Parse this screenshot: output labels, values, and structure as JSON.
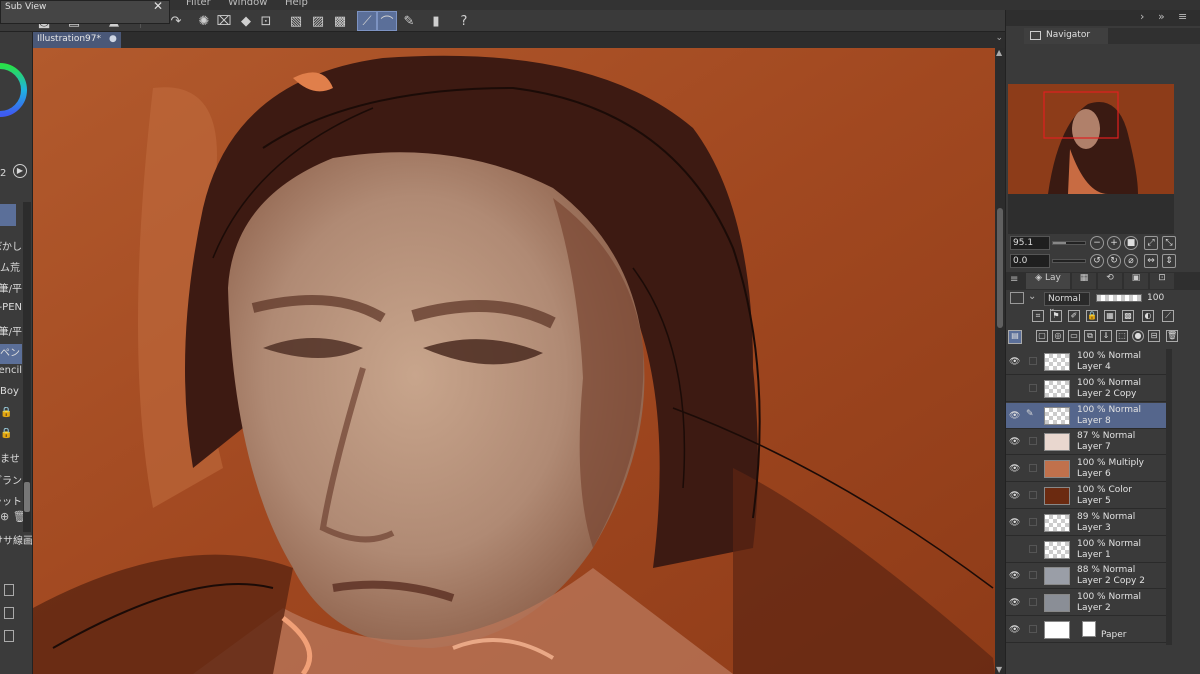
{
  "app": {
    "subview_title": "Sub View",
    "menu": [
      "Filter",
      "Window",
      "Help"
    ]
  },
  "document": {
    "tab_label": "Illustration97*"
  },
  "left_panel": {
    "color_value": "2",
    "items": [
      "ぼかし",
      "ム荒",
      "筆/平",
      "G-PEN",
      "筆/平",
      "ペン",
      "Pencil",
      "Boy",
      "",
      "",
      "ませ",
      "グラン",
      "ラット",
      "けサ線画"
    ]
  },
  "navigator": {
    "tab_label": "Navigator",
    "zoom": "95.1",
    "rotation": "0.0"
  },
  "layer_panel": {
    "tab_label": "Lay",
    "blend_mode": "Normal",
    "opacity": "100",
    "layers": [
      {
        "opacity_mode": "100 % Normal",
        "name": "Layer 4",
        "visible": true,
        "selected": false,
        "thumb_color": "#d0d0d0"
      },
      {
        "opacity_mode": "100 % Normal",
        "name": "Layer 2 Copy",
        "visible": false,
        "selected": false,
        "thumb_color": "#d0d0d0"
      },
      {
        "opacity_mode": "100 % Normal",
        "name": "Layer 8",
        "visible": true,
        "selected": true,
        "thumb_color": "#d0d0d0"
      },
      {
        "opacity_mode": "87 % Normal",
        "name": "Layer 7",
        "visible": true,
        "selected": false,
        "thumb_color": "#e9d7cf"
      },
      {
        "opacity_mode": "100 % Multiply",
        "name": "Layer 6",
        "visible": true,
        "selected": false,
        "thumb_color": "#c0714c"
      },
      {
        "opacity_mode": "100 % Color",
        "name": "Layer 5",
        "visible": true,
        "selected": false,
        "thumb_color": "#6b2a10"
      },
      {
        "opacity_mode": "89 % Normal",
        "name": "Layer 3",
        "visible": true,
        "selected": false,
        "thumb_color": "#d8d8d8"
      },
      {
        "opacity_mode": "100 % Normal",
        "name": "Layer 1",
        "visible": false,
        "selected": false,
        "thumb_color": "#cfcfcf"
      },
      {
        "opacity_mode": "88 % Normal",
        "name": "Layer 2 Copy 2",
        "visible": true,
        "selected": false,
        "thumb_color": "#9a9ea7"
      },
      {
        "opacity_mode": "100 % Normal",
        "name": "Layer 2",
        "visible": true,
        "selected": false,
        "thumb_color": "#8a8e96"
      },
      {
        "opacity_mode": "",
        "name": "Paper",
        "visible": true,
        "selected": false,
        "thumb_color": "#ffffff"
      }
    ]
  },
  "colors": {
    "accent": "#5b6f99",
    "canvas_bg": "#a0461f",
    "panel_bg": "#3a3a3a"
  }
}
